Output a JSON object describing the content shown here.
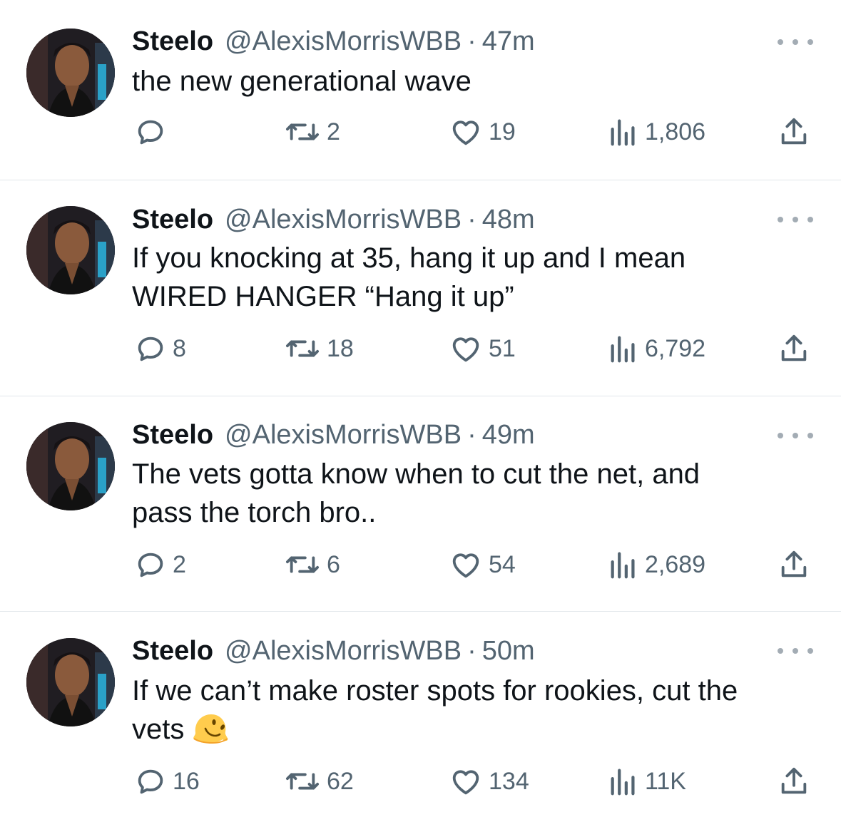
{
  "tweets": [
    {
      "display_name": "Steelo",
      "handle": "@AlexisMorrisWBB",
      "separator": "·",
      "time": "47m",
      "text_lines": [
        "the new generational wave"
      ],
      "replies": "",
      "retweets": "2",
      "likes": "19",
      "views": "1,806"
    },
    {
      "display_name": "Steelo",
      "handle": "@AlexisMorrisWBB",
      "separator": "·",
      "time": "48m",
      "text_lines": [
        "If you knocking at 35, hang it up and I mean",
        "WIRED HANGER “Hang it up”"
      ],
      "replies": "8",
      "retweets": "18",
      "likes": "51",
      "views": "6,792"
    },
    {
      "display_name": "Steelo",
      "handle": "@AlexisMorrisWBB",
      "separator": "·",
      "time": "49m",
      "text_lines": [
        "The vets gotta know when to cut the net, and",
        "pass the torch bro.."
      ],
      "replies": "2",
      "retweets": "6",
      "likes": "54",
      "views": "2,689"
    },
    {
      "display_name": "Steelo",
      "handle": "@AlexisMorrisWBB",
      "separator": "·",
      "time": "50m",
      "text_lines": [
        "If we can’t make roster spots for rookies, cut the",
        "vets"
      ],
      "emoji": "melting-face-emoji",
      "replies": "16",
      "retweets": "62",
      "likes": "134",
      "views": "11K"
    }
  ],
  "colors": {
    "text": "#0f1419",
    "secondary": "#536471",
    "divider": "#e1e6ea",
    "emoji_yellow": "#ffcc4d"
  },
  "icons": [
    "reply-icon",
    "retweet-icon",
    "like-icon",
    "views-icon",
    "share-icon",
    "more-icon",
    "avatar"
  ]
}
